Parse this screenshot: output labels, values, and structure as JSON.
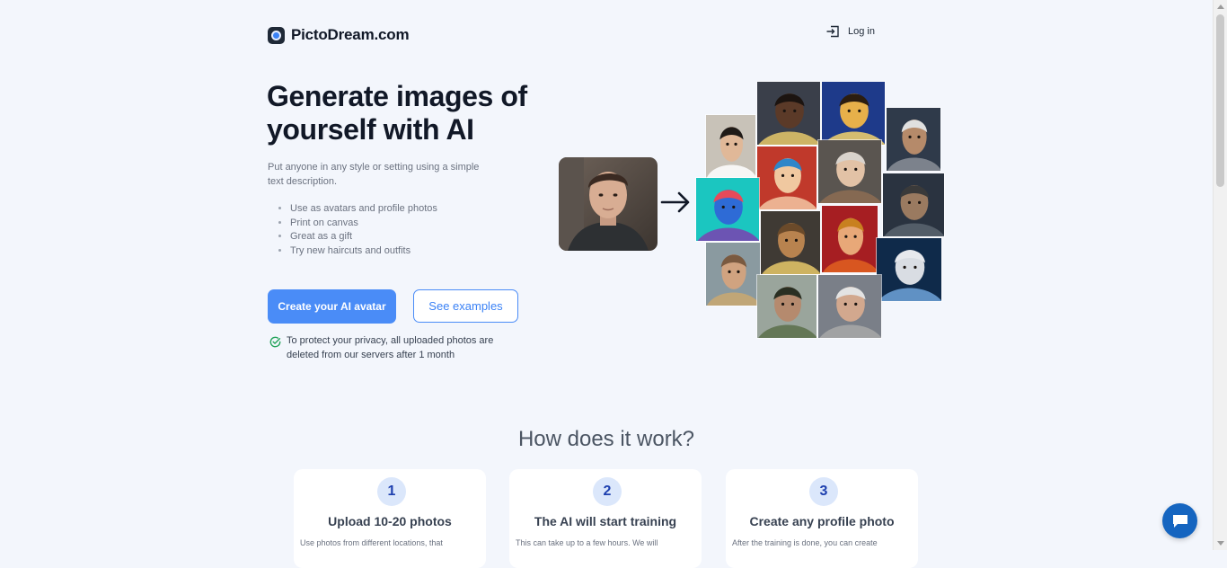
{
  "header": {
    "logo_text": "PictoDream.com",
    "login_label": "Log in"
  },
  "hero": {
    "title": "Generate images of yourself with AI",
    "description": "Put anyone in any style or setting using a simple text description.",
    "features": [
      "Use as avatars and profile photos",
      "Print on canvas",
      "Great as a gift",
      "Try new haircuts and outfits"
    ],
    "cta_primary": "Create your AI avatar",
    "cta_secondary": "See examples",
    "privacy_note": "To protect your privacy, all uploaded photos are deleted from our servers after 1 month"
  },
  "how": {
    "title": "How does it work?",
    "steps": [
      {
        "number": "1",
        "title": "Upload 10-20 photos",
        "text": "Use photos from different locations, that"
      },
      {
        "number": "2",
        "title": "The AI will start training",
        "text": "This can take up to a few hours. We will"
      },
      {
        "number": "3",
        "title": "Create any profile photo",
        "text": "After the training is done, you can create"
      }
    ]
  },
  "colors": {
    "page_bg": "#f3f6fc",
    "accent": "#4a8cf7",
    "chat_button": "#1565c0",
    "check_icon": "#22a35a"
  },
  "icons": {
    "login": "login-arrow-icon",
    "privacy": "check-circle-icon",
    "arrow": "arrow-right-icon",
    "chat": "chat-bubble-icon"
  }
}
